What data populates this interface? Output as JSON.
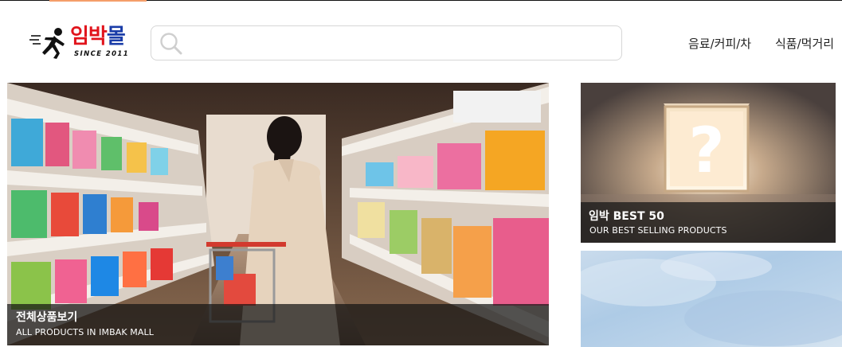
{
  "header": {
    "logo": {
      "text_part1": "임",
      "text_part2": "박",
      "text_part3": "몰",
      "since": "SINCE 2011"
    },
    "search": {
      "placeholder": "",
      "value": ""
    },
    "nav": [
      {
        "label": "음료/커피/차"
      },
      {
        "label": "식품/먹거리"
      }
    ]
  },
  "banners": {
    "main": {
      "title": "전체상품보기",
      "subtitle": "ALL PRODUCTS IN IMBAK MALL"
    },
    "best": {
      "title": "임박 BEST 50",
      "subtitle": "OUR BEST SELLING PRODUCTS"
    }
  },
  "colors": {
    "accent": "#f59e6a",
    "logo_red": "#e1141c",
    "logo_blue": "#1a3da8",
    "caption_bg": "#141414"
  }
}
